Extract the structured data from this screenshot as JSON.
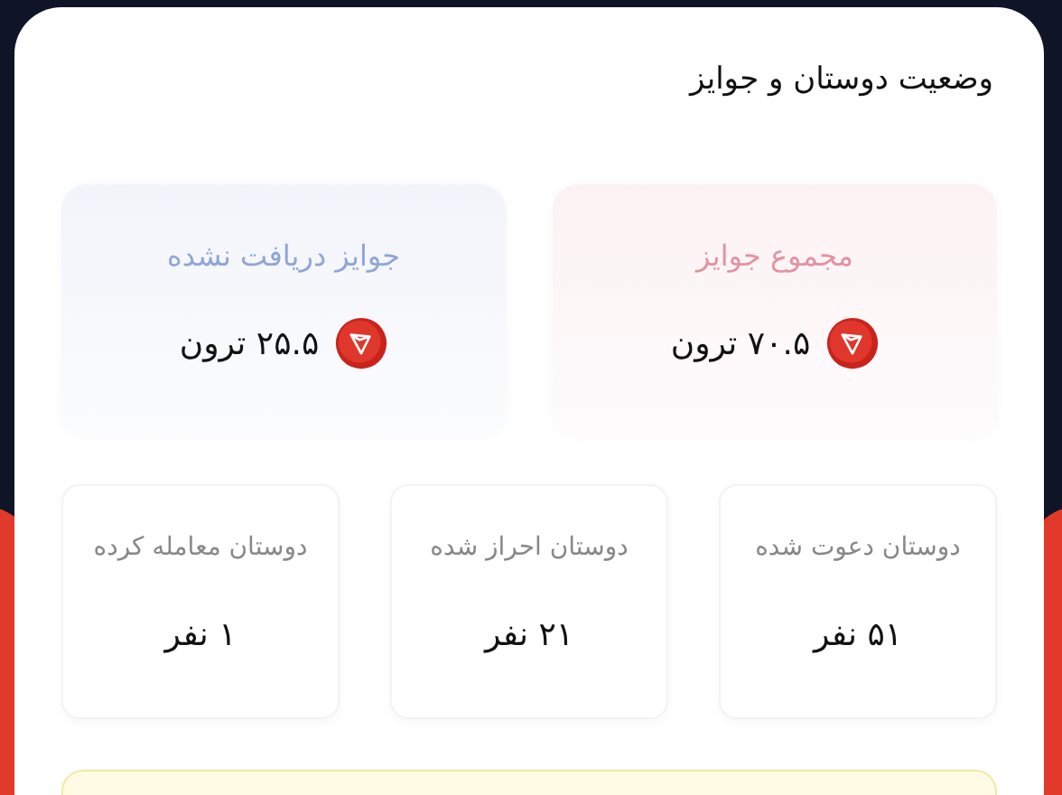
{
  "panel": {
    "title": "وضعیت دوستان و جوایز"
  },
  "prizes": [
    {
      "label": "مجموع جوایز",
      "value": "۷۰.۵ ترون",
      "color": "#e393a3"
    },
    {
      "label": "جوایز دریافت نشده",
      "value": "۲۵.۵ ترون",
      "color": "#8fa6d8"
    }
  ],
  "friends": [
    {
      "label": "دوستان دعوت شده",
      "value": "۵۱ نفر"
    },
    {
      "label": "دوستان احراز شده",
      "value": "۲۱ نفر"
    },
    {
      "label": "دوستان معامله کرده",
      "value": "۱ نفر"
    }
  ]
}
